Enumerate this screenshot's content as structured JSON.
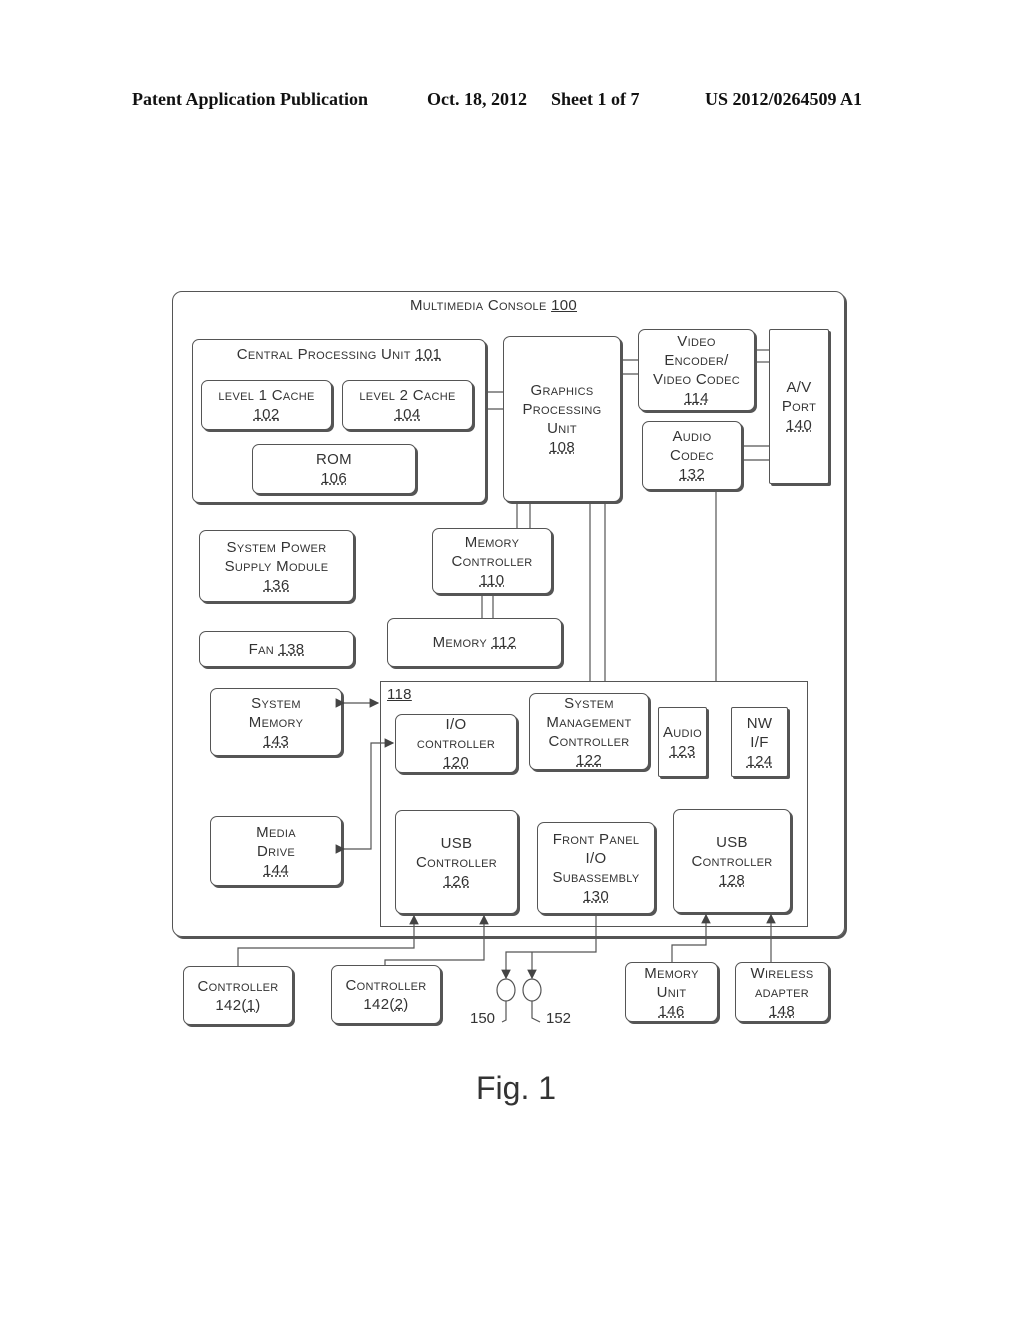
{
  "header": {
    "publication": "Patent Application Publication",
    "date": "Oct. 18, 2012",
    "sheet": "Sheet 1 of 7",
    "patent_number": "US 2012/0264509 A1"
  },
  "diagram": {
    "console": {
      "label": "Multimedia Console",
      "num": "100"
    },
    "cpu": {
      "label": "Central Processing Unit",
      "num": "101"
    },
    "l1": {
      "label": "level 1 Cache",
      "num": "102"
    },
    "l2": {
      "label": "level 2 Cache",
      "num": "104"
    },
    "rom": {
      "label": "ROM",
      "num": "106"
    },
    "gpu": {
      "line1": "Graphics",
      "line2": "Processing",
      "line3": "Unit",
      "num": "108"
    },
    "video": {
      "line1": "Video",
      "line2": "Encoder/",
      "line3": "Video Codec",
      "num": "114"
    },
    "av": {
      "line1": "A/V",
      "line2": "Port",
      "num": "140"
    },
    "audio_codec": {
      "line1": "Audio",
      "line2": "Codec",
      "num": "132"
    },
    "power": {
      "line1": "System Power",
      "line2": "Supply Module",
      "num": "136"
    },
    "memctrl": {
      "line1": "Memory",
      "line2": "Controller",
      "num": "110"
    },
    "fan": {
      "label": "Fan",
      "num": "138"
    },
    "memory": {
      "label": "Memory",
      "num": "112"
    },
    "sysmem": {
      "line1": "System",
      "line2": "Memory",
      "num": "143"
    },
    "io_block": {
      "num": "118"
    },
    "ioctrl": {
      "line1": "I/O",
      "line2": "controller",
      "num": "120"
    },
    "smc": {
      "line1": "System",
      "line2": "Management",
      "line3": "Controller",
      "num": "122"
    },
    "audio": {
      "line1": "Audio",
      "num": "123"
    },
    "nw": {
      "line1": "NW",
      "line2": "I/F",
      "num": "124"
    },
    "media": {
      "line1": "Media",
      "line2": "Drive",
      "num": "144"
    },
    "usb1": {
      "line1": "USB",
      "line2": "Controller",
      "num": "126"
    },
    "fp": {
      "line1": "Front Panel",
      "line2": "I/O",
      "line3": "Subassembly",
      "num": "130"
    },
    "usb2": {
      "line1": "USB",
      "line2": "Controller",
      "num": "128"
    },
    "ctrl1": {
      "line1": "Controller",
      "base": "142(",
      "idx": "1",
      "close": ")"
    },
    "ctrl2": {
      "line1": "Controller",
      "base": "142(",
      "idx": "2",
      "close": ")"
    },
    "memunit": {
      "line1": "Memory",
      "line2": "Unit",
      "num": "146"
    },
    "wireless": {
      "line1": "Wireless",
      "line2": "adapter",
      "num": "148"
    },
    "ref150": "150",
    "ref152": "152"
  },
  "figure_caption": "Fig. 1"
}
